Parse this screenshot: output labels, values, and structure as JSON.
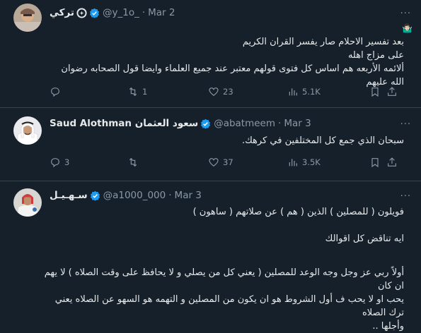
{
  "tweets": [
    {
      "name": "تركي",
      "handle": "@y_1o_",
      "date": "Mar 2",
      "more_label": "···",
      "lines": [
        "بعد تفسير الاحلام صار يفسر القران الكريم",
        "على مزاج اهله",
        "ألائمه الأربعه هم اساس كل فتوى قولهم معتبر عند جميع العلماء وايضا قول الصحابه رضوان الله عليهم"
      ],
      "reply_count": "",
      "retweet_count": "1",
      "like_count": "23",
      "view_count": "5.1K"
    },
    {
      "name": "Saud Alothman سعود العثمان",
      "handle": "@abatmeem",
      "date": "Mar 3",
      "more_label": "···",
      "lines": [
        "سبحان الذي جمع كل المختلفين في كرهك."
      ],
      "reply_count": "3",
      "retweet_count": "",
      "like_count": "37",
      "view_count": "3.5K"
    },
    {
      "name": "سـهـيـل",
      "handle": "@a1000_000",
      "date": "Mar 3",
      "more_label": "···",
      "lines": [
        "فويلون ( للمصلين ) الذين ( هم ) عن صلاتهم ( ساهون )",
        "",
        "ايه تناقض كل اقوالك",
        "",
        "أولاً ربي عز وجل وجه الوعد للمصلين ( يعني كل من يصلي و لا يحافظ على وقت الصلاه ) لا يهم ان كان",
        "يحب او لا يحب  ف أول الشروط هو ان يكون من المصلين و التهمه هو السهو عن الصلاه يعني ترك الصلاه",
        "وأجلها .."
      ]
    }
  ],
  "colors": {
    "background": "#15202b",
    "divider": "#38444d",
    "text": "#e7e9ea",
    "muted": "#8b98a5",
    "verified": "#1d9bf0"
  },
  "icons": [
    "verified-icon",
    "affiliate-badge-icon",
    "reply-icon",
    "retweet-icon",
    "like-icon",
    "views-icon",
    "bookmark-icon",
    "share-icon",
    "more-icon"
  ]
}
